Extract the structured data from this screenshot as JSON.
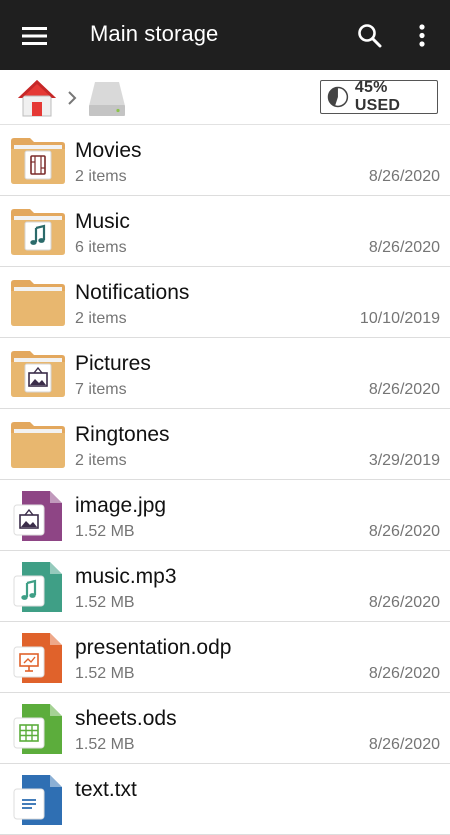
{
  "header": {
    "title": "Main storage",
    "menu_icon": "hamburger-menu-icon",
    "search_icon": "search-icon",
    "more_icon": "more-vertical-icon",
    "background": "#1f1f1f"
  },
  "breadcrumb": {
    "home_icon": "home-icon",
    "separator_icon": "chevron-right-icon",
    "drive_icon": "drive-icon",
    "usage_label": "45% USED",
    "usage_percent": 45
  },
  "items": [
    {
      "name": "Movies",
      "meta": "2 items",
      "date": "8/26/2020",
      "kind": "folder",
      "badge": "film-icon"
    },
    {
      "name": "Music",
      "meta": "6 items",
      "date": "8/26/2020",
      "kind": "folder",
      "badge": "music-note-icon"
    },
    {
      "name": "Notifications",
      "meta": "2 items",
      "date": "10/10/2019",
      "kind": "folder",
      "badge": ""
    },
    {
      "name": "Pictures",
      "meta": "7 items",
      "date": "8/26/2020",
      "kind": "folder",
      "badge": "picture-icon"
    },
    {
      "name": "Ringtones",
      "meta": "2 items",
      "date": "3/29/2019",
      "kind": "folder",
      "badge": ""
    },
    {
      "name": "image.jpg",
      "meta": "1.52 MB",
      "date": "8/26/2020",
      "kind": "file",
      "color": "#8e4585",
      "badge": "picture-icon"
    },
    {
      "name": "music.mp3",
      "meta": "1.52 MB",
      "date": "8/26/2020",
      "kind": "file",
      "color": "#3f9f86",
      "badge": "music-note-icon"
    },
    {
      "name": "presentation.odp",
      "meta": "1.52 MB",
      "date": "8/26/2020",
      "kind": "file",
      "color": "#e0622b",
      "badge": "presentation-icon"
    },
    {
      "name": "sheets.ods",
      "meta": "1.52 MB",
      "date": "8/26/2020",
      "kind": "file",
      "color": "#5cad3c",
      "badge": "spreadsheet-icon"
    },
    {
      "name": "text.txt",
      "meta": "",
      "date": "",
      "kind": "file",
      "color": "#2f6fb3",
      "badge": "text-lines-icon"
    }
  ],
  "colors": {
    "folder": "#e3a85e",
    "folder_front": "#e8b76f",
    "paper": "#f2f2f2"
  }
}
